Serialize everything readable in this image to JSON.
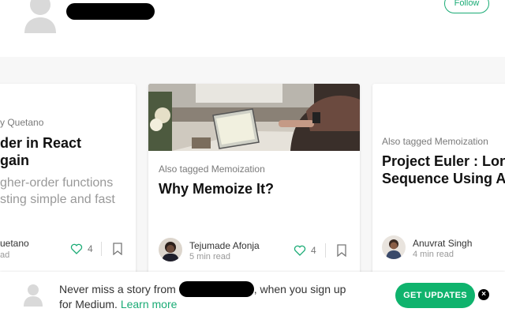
{
  "header": {
    "follow_label": "Follow"
  },
  "cards": [
    {
      "tag_fragment": "y Quetano",
      "title_lines": [
        "der in React",
        "gain"
      ],
      "subtitle_lines": [
        "gher-order functions",
        "sting simple and fast"
      ],
      "author_fragment": "uetano",
      "read_fragment": "ad",
      "claps": "4"
    },
    {
      "tag": "Also tagged Memoization",
      "title": "Why Memoize It?",
      "author": "Tejumade Afonja",
      "read_time": "5 min read",
      "claps": "4"
    },
    {
      "tag": "Also tagged Memoization",
      "title_lines": [
        "Project Euler : Long",
        "Sequence Using A"
      ],
      "author": "Anuvrat Singh",
      "read_time": "4 min read"
    }
  ],
  "banner": {
    "text_before": "Never miss a story from",
    "text_after": ", when you sign up",
    "text_line2": "for Medium.",
    "learn_more": "Learn more",
    "button_label": "GET UPDATES",
    "close_glyph": "×"
  },
  "icons": {
    "clap": "heart-outline-icon",
    "bookmark": "bookmark-icon",
    "close": "close-icon"
  },
  "colors": {
    "accent": "#1aab75",
    "button": "#0fb36d",
    "background_band": "#f7f7f7"
  }
}
